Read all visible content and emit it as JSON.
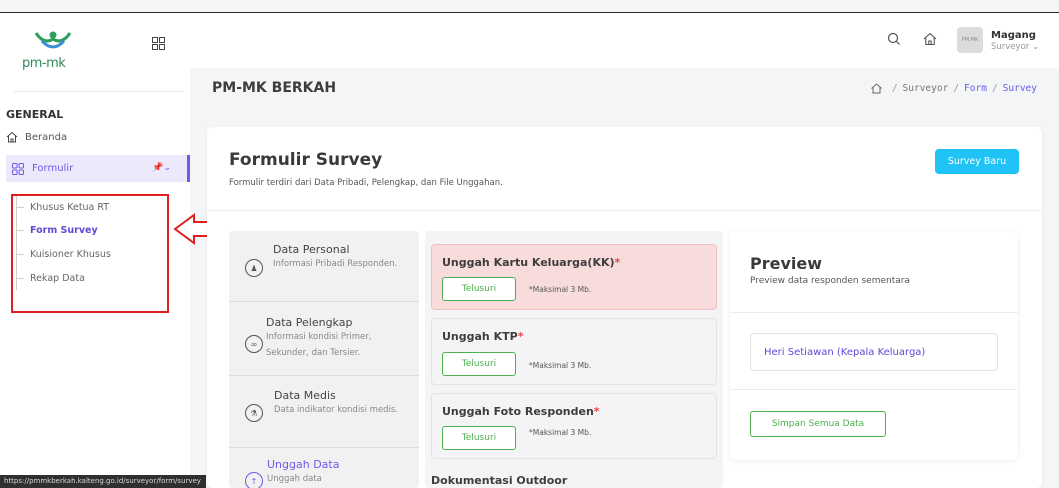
{
  "sidebar": {
    "logo_text": "pm-mk",
    "heading": "GENERAL",
    "items": [
      {
        "label": "Beranda",
        "icon": "home-icon"
      },
      {
        "label": "Formulir",
        "icon": "grid-icon"
      }
    ],
    "submenu": [
      {
        "label": "Khusus Ketua RT",
        "active": false
      },
      {
        "label": "Form Survey",
        "active": true
      },
      {
        "label": "Kuisioner Khusus",
        "active": false
      },
      {
        "label": "Rekap Data",
        "active": false
      }
    ]
  },
  "status_url": "https://pmmkberkah.kalteng.go.id/surveyor/form/survey",
  "topbar": {
    "avatar_text": "PM.MK",
    "user_name": "Magang",
    "user_role": "Surveyor"
  },
  "page": {
    "title": "PM-MK BERKAH",
    "breadcrumb": [
      "Surveyor",
      "Form",
      "Survey"
    ]
  },
  "card": {
    "title": "Formulir Survey",
    "subtitle": "Formulir terdiri dari Data Pribadi, Pelengkap, dan File Unggahan.",
    "new_button": "Survey Baru"
  },
  "steps": [
    {
      "title": "Data Personal",
      "desc": "Informasi Pribadi Responden.",
      "icon": "user-icon"
    },
    {
      "title": "Data Pelengkap",
      "desc": "Informasi kondisi Primer, Sekunder, dan Tersier.",
      "icon": "link-icon"
    },
    {
      "title": "Data Medis",
      "desc": "Data indikator kondisi medis.",
      "icon": "medical-icon"
    },
    {
      "title": "Unggah Data",
      "desc": "Unggah data",
      "icon": "upload-icon"
    }
  ],
  "uploads": [
    {
      "title": "Unggah Kartu Keluarga(KK)",
      "button": "Telusuri",
      "note": "*Maksimal 3 Mb."
    },
    {
      "title": "Unggah KTP",
      "button": "Telusuri",
      "note": "*Maksimal 3 Mb."
    },
    {
      "title": "Unggah Foto Responden",
      "button": "Telusuri",
      "note": "*Maksimal 3 Mb."
    }
  ],
  "doc_title": "Dokumentasi Outdoor",
  "preview": {
    "title": "Preview",
    "subtitle": "Preview data responden sementara",
    "name": "Heri Setiawan (Kepala Keluarga)",
    "save_button": "Simpan Semua Data"
  },
  "colors": {
    "accent": "#6c5ce7",
    "primary_button": "#1fc3f5",
    "success": "#4caf50",
    "error_bg": "#f8dcdc",
    "annotation": "#e02020"
  }
}
